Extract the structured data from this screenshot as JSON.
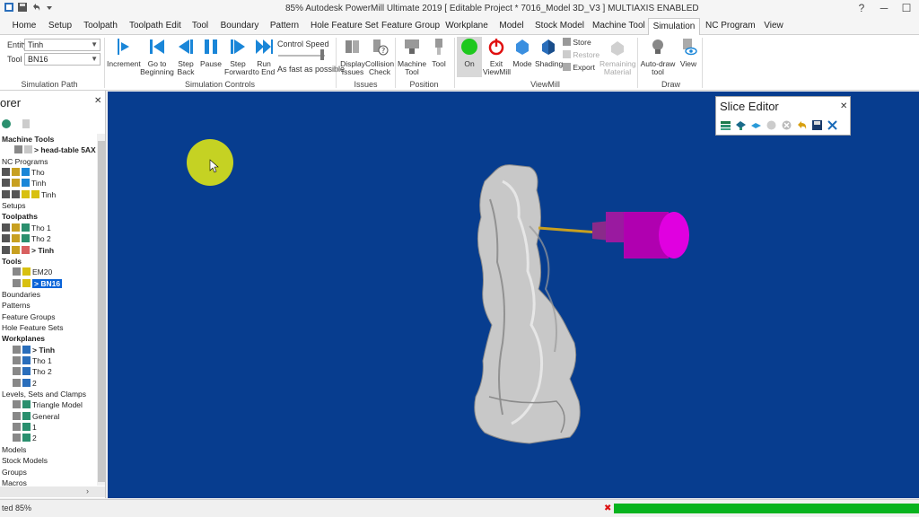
{
  "window": {
    "title": "85% Autodesk PowerMill Ultimate 2019   [ Editable Project * 7016_Model 3D_V3 ]   MULTIAXIS ENABLED"
  },
  "tabs": [
    "Home",
    "Setup",
    "Toolpath",
    "Toolpath Edit",
    "Tool",
    "Boundary",
    "Pattern",
    "Hole Feature Set",
    "Feature Group",
    "Workplane",
    "Model",
    "Stock Model",
    "Machine Tool",
    "Simulation",
    "NC Program",
    "View"
  ],
  "active_tab": "Simulation",
  "ribbon": {
    "simulation_path": {
      "entity_label": "Entity",
      "entity_value": "Tinh",
      "tool_label": "Tool",
      "tool_value": "BN16",
      "group_label": "Simulation Path"
    },
    "simulation_controls": {
      "increment": "Increment",
      "go_to_beginning": "Go to\nBeginning",
      "step_back": "Step\nBack",
      "pause": "Pause",
      "step_forward": "Step\nForward",
      "run_to_end": "Run\nto End",
      "control_speed": "Control Speed",
      "speed_value": "As fast as possible",
      "group_label": "Simulation Controls"
    },
    "issues": {
      "display_issues": "Display\nIssues",
      "collision_check": "Collision\nCheck",
      "group_label": "Issues"
    },
    "position": {
      "machine_tool": "Machine\nTool",
      "tool": "Tool",
      "group_label": "Position"
    },
    "viewmill": {
      "on": "On",
      "exit_viewmill": "Exit\nViewMill",
      "mode": "Mode",
      "shading": "Shading",
      "store": "Store",
      "restore": "Restore",
      "export": "Export",
      "remaining_material": "Remaining\nMaterial",
      "group_label": "ViewMill"
    },
    "draw": {
      "auto_draw_tool": "Auto-draw\ntool",
      "view": "View",
      "group_label": "Draw"
    }
  },
  "explorer": {
    "title": "orer",
    "items": [
      {
        "label": "Machine Tools",
        "bold": true
      },
      {
        "label": "> head-table 5AX",
        "bold": true
      },
      {
        "label": "NC Programs",
        "bold": false
      },
      {
        "label": "Tho",
        "bold": false
      },
      {
        "label": "Tinh",
        "bold": false
      },
      {
        "label": "Tinh",
        "bold": false
      },
      {
        "label": "Setups",
        "bold": false
      },
      {
        "label": "Toolpaths",
        "bold": true
      },
      {
        "label": "Tho 1",
        "bold": false
      },
      {
        "label": "Tho 2",
        "bold": false
      },
      {
        "label": "> Tinh",
        "bold": true
      },
      {
        "label": "Tools",
        "bold": true
      },
      {
        "label": "EM20",
        "bold": false
      },
      {
        "label": "> BN16",
        "bold": true
      },
      {
        "label": "Boundaries",
        "bold": false
      },
      {
        "label": "Patterns",
        "bold": false
      },
      {
        "label": "Feature Groups",
        "bold": false
      },
      {
        "label": "Hole Feature Sets",
        "bold": false
      },
      {
        "label": "Workplanes",
        "bold": true
      },
      {
        "label": "> Tinh",
        "bold": true
      },
      {
        "label": "Tho 1",
        "bold": false
      },
      {
        "label": "Tho 2",
        "bold": false
      },
      {
        "label": "2",
        "bold": false
      },
      {
        "label": "Levels, Sets and Clamps",
        "bold": false
      },
      {
        "label": "Triangle Model",
        "bold": false
      },
      {
        "label": "General",
        "bold": false
      },
      {
        "label": "1",
        "bold": false
      },
      {
        "label": "2",
        "bold": false
      },
      {
        "label": "Models",
        "bold": false
      },
      {
        "label": "Stock Models",
        "bold": false
      },
      {
        "label": "Groups",
        "bold": false
      },
      {
        "label": "Macros",
        "bold": false
      }
    ]
  },
  "slice_editor": {
    "title": "Slice Editor"
  },
  "status": {
    "text": "ted 85%",
    "progress": 1.0
  },
  "colors": {
    "viewport": "#073d8f",
    "accent": "#0a64d8",
    "tool_holder": "#b000b0",
    "cursor_highlight": "#d6de1a",
    "progress": "#07b31e"
  }
}
